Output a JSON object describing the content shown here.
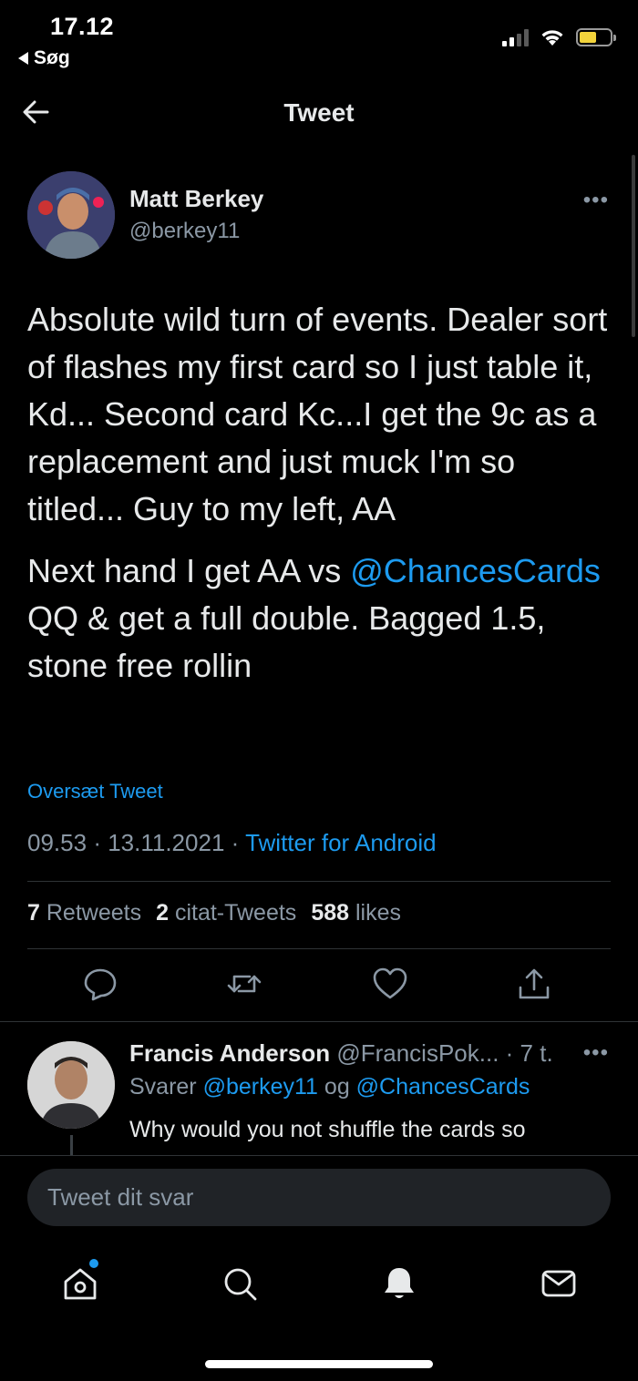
{
  "status_bar": {
    "time": "17.12",
    "back_app": "Søg"
  },
  "header": {
    "title": "Tweet"
  },
  "tweet": {
    "author_name": "Matt Berkey",
    "author_handle": "@berkey11",
    "paragraph1": "Absolute wild turn of events. Dealer sort of flashes my first card so I just table it, Kd... Second card Kc...I get the 9c as a replacement and just muck I'm so titled... Guy to my left, AA",
    "paragraph2_before": "Next hand I get AA vs ",
    "paragraph2_mention": "@ChancesCards",
    "paragraph2_after": " QQ & get a full double. Bagged 1.5, stone free rollin",
    "translate_label": "Oversæt Tweet",
    "time": "09.53",
    "date": "13.11.2021",
    "source": "Twitter for Android",
    "retweets_count": "7",
    "retweets_label": "Retweets",
    "quotes_count": "2",
    "quotes_label": "citat-Tweets",
    "likes_count": "588",
    "likes_label": "likes"
  },
  "reply": {
    "name": "Francis Anderson",
    "handle": "@FrancisPok...",
    "time": "· 7 t.",
    "replying_prefix": "Svarer ",
    "replying_mention1": "@berkey11",
    "replying_and": " og ",
    "replying_mention2": "@ChancesCards",
    "text": "Why would you not shuffle the cards so"
  },
  "composer": {
    "placeholder": "Tweet dit svar"
  },
  "colors": {
    "accent": "#1d9bf0",
    "background": "#000000",
    "secondary_text": "#8b98a5",
    "battery": "#f2d33b"
  },
  "icons": {
    "actions": [
      "reply-icon",
      "retweet-icon",
      "like-icon",
      "share-icon"
    ],
    "tabs": [
      "home-icon",
      "search-icon",
      "notifications-icon",
      "messages-icon"
    ]
  }
}
